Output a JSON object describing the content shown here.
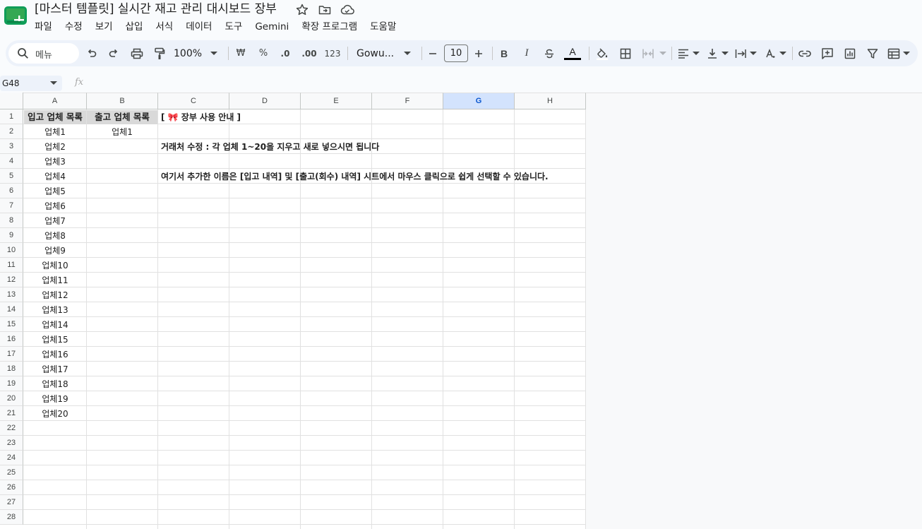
{
  "document": {
    "title": "[마스터 템플릿] 실시간 재고 관리 대시보드 장부"
  },
  "menu": [
    "파일",
    "수정",
    "보기",
    "삽입",
    "서식",
    "데이터",
    "도구",
    "Gemini",
    "확장 프로그램",
    "도움말"
  ],
  "toolbar": {
    "search_label": "메뉴",
    "zoom": "100%",
    "currency": "₩",
    "percent": "%",
    "decrease_decimal": ".0",
    "increase_decimal": ".00",
    "number_format": "123",
    "font": "Gowu...",
    "font_size": "10",
    "bold": "B",
    "italic": "I",
    "text_color_letter": "A"
  },
  "formula_bar": {
    "cell_ref": "G48",
    "fx": "fx",
    "value": ""
  },
  "grid": {
    "columns": [
      "A",
      "B",
      "C",
      "D",
      "E",
      "F",
      "G",
      "H"
    ],
    "selected_column": "G",
    "rows": [
      "1",
      "2",
      "3",
      "4",
      "5",
      "6",
      "7",
      "8",
      "9",
      "10",
      "11",
      "12",
      "13",
      "14",
      "15",
      "16",
      "17",
      "18",
      "19",
      "20",
      "21",
      "22",
      "23",
      "24",
      "25",
      "26",
      "27",
      "28"
    ],
    "header_a": "입고 업체 목록",
    "header_b": "출고 업체 목록",
    "col_a_values": [
      "업체1",
      "업체2",
      "업체3",
      "업체4",
      "업체5",
      "업체6",
      "업체7",
      "업체8",
      "업체9",
      "업체10",
      "업체11",
      "업체12",
      "업체13",
      "업체14",
      "업체15",
      "업체16",
      "업체17",
      "업체18",
      "업체19",
      "업체20"
    ],
    "col_b_values": [
      "업체1"
    ],
    "guide_title": "[ 🎀 장부 사용 안내 ]",
    "guide_line1": "거래처 수정 : 각 업체 1~20을 지우고 새로 넣으시면 됩니다",
    "guide_line2": "여기서 추가한 이름은 [입고 내역] 및 [출고(회수) 내역] 시트에서 마우스 클릭으로 쉽게 선택할 수 있습니다."
  },
  "colors": {
    "accent": "#0b57d0",
    "selected_header": "#d3e3fd",
    "header_fill": "#d9d9d9",
    "logo": "#0f9d58"
  }
}
